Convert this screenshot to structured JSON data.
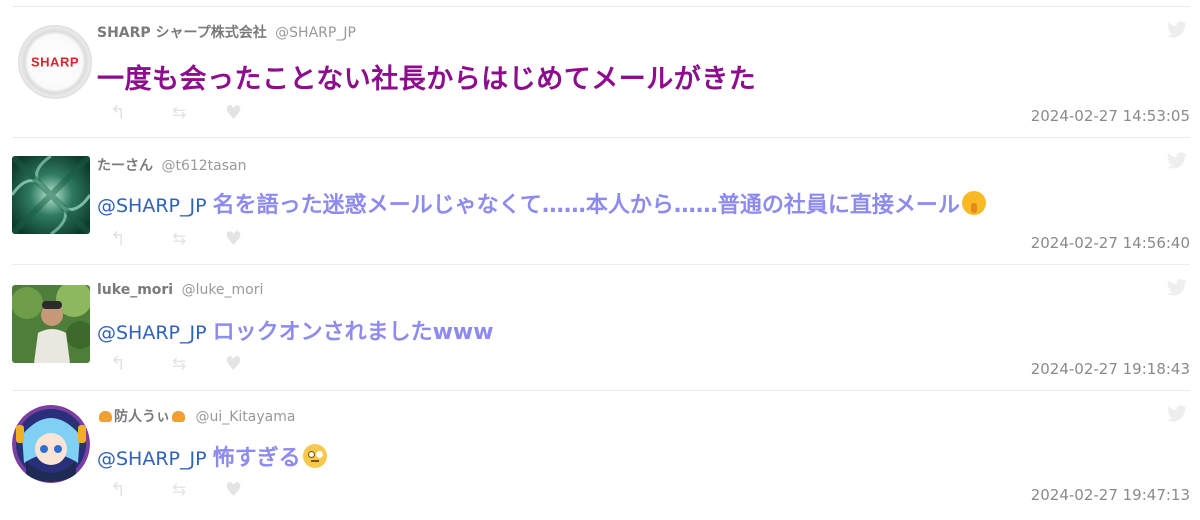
{
  "tweets": [
    {
      "display_name": "SHARP シャープ株式会社",
      "handle": "@SHARP_JP",
      "avatar_text": "SHARP",
      "mention": "",
      "text": "一度も会ったことない社長からはじめてメールがきた",
      "timestamp": "2024-02-27 14:53:05"
    },
    {
      "display_name": "たーさん",
      "handle": "@t612tasan",
      "mention": "@SHARP_JP",
      "text": "名を語った迷惑メールじゃなくて……本人から……普通の社員に直接メール",
      "emoji": "shushing-face-emoji",
      "timestamp": "2024-02-27 14:56:40"
    },
    {
      "display_name": "luke_mori",
      "handle": "@luke_mori",
      "mention": "@SHARP_JP",
      "text": "ロックオンされましたwww",
      "timestamp": "2024-02-27 19:18:43"
    },
    {
      "display_name": "防人うぃ",
      "handle": "@ui_Kitayama",
      "mention": "@SHARP_JP",
      "text": "怖すぎる",
      "emoji": "face-with-rolling-eyes-emoji",
      "timestamp": "2024-02-27 19:47:13"
    }
  ],
  "icons": {
    "reply": "reply-icon",
    "retweet": "retweet-icon",
    "like": "heart-icon",
    "brand": "twitter-bird-icon"
  },
  "colors": {
    "original_tweet_text": "#8e0d8f",
    "reply_text": "#8e8bef",
    "mention": "#2f62b8",
    "action_icons": "#e4e4e4"
  }
}
